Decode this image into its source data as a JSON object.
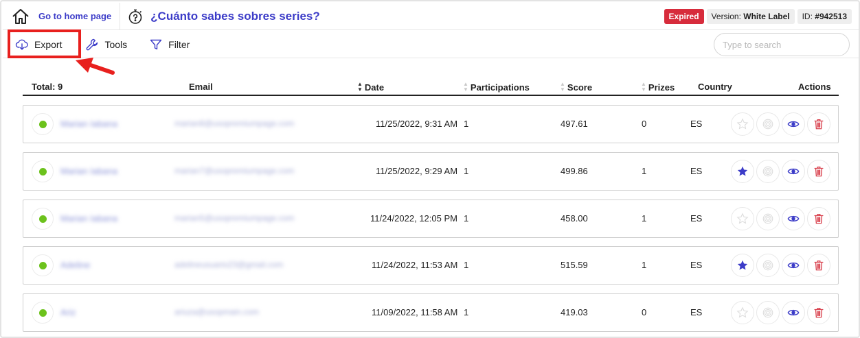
{
  "header": {
    "home_label": "Go to home page",
    "title": "¿Cuánto sabes sobres series?",
    "status_badge": "Expired",
    "version_label": "Version:",
    "version_value": "White Label",
    "id_label": "ID:",
    "id_value": "#942513"
  },
  "toolbar": {
    "export_label": "Export",
    "tools_label": "Tools",
    "filter_label": "Filter",
    "search_placeholder": "Type to search"
  },
  "table": {
    "total_label": "Total: 9",
    "columns": {
      "email": "Email",
      "date": "Date",
      "participations": "Participations",
      "score": "Score",
      "prizes": "Prizes",
      "country": "Country",
      "actions": "Actions"
    },
    "rows": [
      {
        "name": "Marian Iabana",
        "email": "marian8@usopremiumpage.com",
        "date": "11/25/2022, 9:31 AM",
        "participations": "1",
        "score": "497.61",
        "prizes": "0",
        "country": "ES",
        "starred": false
      },
      {
        "name": "Marian Iabana",
        "email": "marian7@usopremiumpage.com",
        "date": "11/25/2022, 9:29 AM",
        "participations": "1",
        "score": "499.86",
        "prizes": "1",
        "country": "ES",
        "starred": true
      },
      {
        "name": "Marian Iabana",
        "email": "marian5@usopremiumpage.com",
        "date": "11/24/2022, 12:05 PM",
        "participations": "1",
        "score": "458.00",
        "prizes": "1",
        "country": "ES",
        "starred": false
      },
      {
        "name": "Adeline",
        "email": "adelineusuario23@gmail.com",
        "date": "11/24/2022, 11:53 AM",
        "participations": "1",
        "score": "515.59",
        "prizes": "1",
        "country": "ES",
        "starred": true
      },
      {
        "name": "Ariz",
        "email": "ariuza@usopmain.com",
        "date": "11/09/2022, 11:58 AM",
        "participations": "1",
        "score": "419.03",
        "prizes": "0",
        "country": "ES",
        "starred": false
      }
    ]
  },
  "colors": {
    "brand": "#3c3cc8",
    "expired": "#d72c3c",
    "highlight": "#e8201e",
    "status_dot": "#6cc21c",
    "delete": "#d9434f"
  },
  "icons": {
    "home": "home-icon",
    "title": "stopwatch-question-icon",
    "export": "cloud-download-icon",
    "tools": "wrench-icon",
    "filter": "funnel-icon",
    "star": "star-icon",
    "target": "target-icon",
    "view": "eye-icon",
    "delete": "trash-icon"
  }
}
